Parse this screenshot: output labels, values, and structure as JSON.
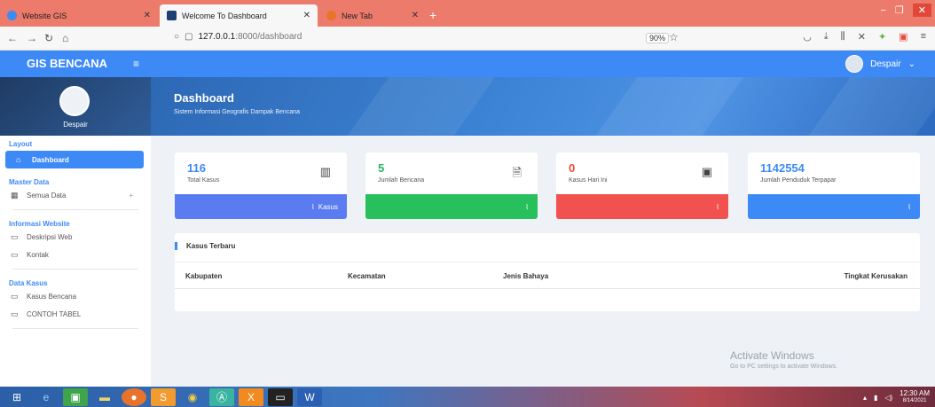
{
  "browser": {
    "tabs": [
      {
        "label": "Website GIS",
        "color": "#3d8af7"
      },
      {
        "label": "Welcome To Dashboard",
        "color": "#1e3f74"
      },
      {
        "label": "New Tab",
        "color": "#e8732b"
      }
    ],
    "url_host": "127.0.0.1",
    "url_path": ":8000/dashboard",
    "zoom": "90%"
  },
  "header": {
    "brand": "GIS BENCANA",
    "user": "Despair"
  },
  "sidebar": {
    "user_name": "Despair",
    "sections": {
      "layout": "Layout",
      "master": "Master Data",
      "info": "Informasi Website",
      "kasus": "Data Kasus"
    },
    "items": {
      "dashboard": "Dashboard",
      "semua_data": "Semua Data",
      "deskripsi": "Deskripsi Web",
      "kontak": "Kontak",
      "kasus_bencana": "Kasus Bencana",
      "contoh_tabel": "CONTOH TABEL"
    }
  },
  "banner": {
    "title": "Dashboard",
    "subtitle": "Sistem Informasi Geografis Dampak Bencana"
  },
  "cards": [
    {
      "value": "116",
      "caption": "Total Kasus",
      "bar_label": "Kasus",
      "value_color": "#3d8af7",
      "bar_color": "#5b7cf0"
    },
    {
      "value": "5",
      "caption": "Jumlah Bencana",
      "bar_label": "",
      "value_color": "#28b463",
      "bar_color": "#27c05c"
    },
    {
      "value": "0",
      "caption": "Kasus Hari Ini",
      "bar_label": "",
      "value_color": "#e74c3c",
      "bar_color": "#f2524f"
    },
    {
      "value": "1142554",
      "caption": "Jumlah Penduduk Terpapar",
      "bar_label": "",
      "value_color": "#3d8af7",
      "bar_color": "#3d8af7"
    }
  ],
  "table": {
    "title": "Kasus Terbaru",
    "columns": [
      "Kabupaten",
      "Kecamatan",
      "Jenis Bahaya",
      "Tingkat Kerusakan"
    ]
  },
  "watermark": {
    "line1": "Activate Windows",
    "line2": "Go to PC settings to activate Windows."
  },
  "taskbar": {
    "time": "12:30 AM",
    "date": "8/14/2021"
  }
}
